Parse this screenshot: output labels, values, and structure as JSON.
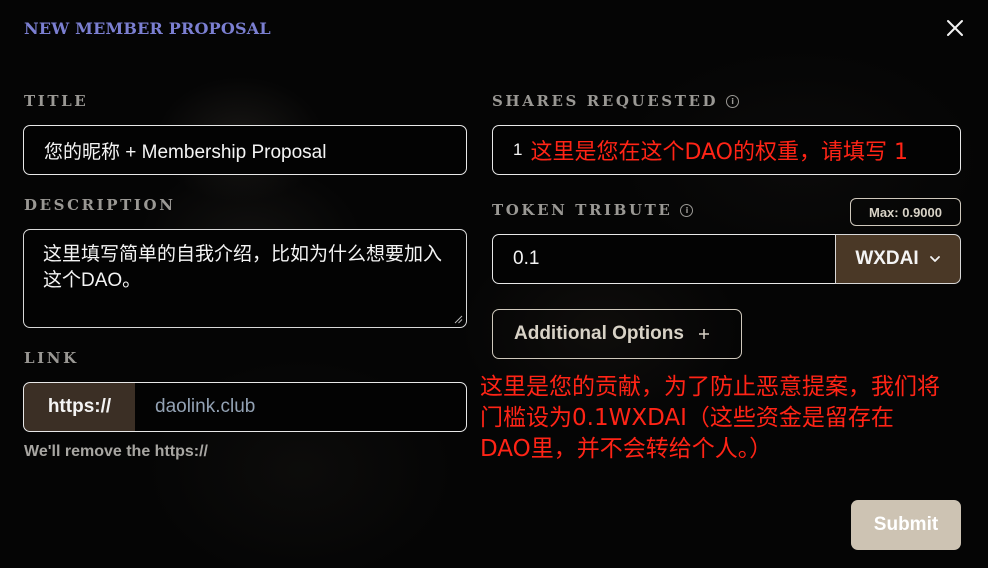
{
  "modal": {
    "title": "NEW MEMBER PROPOSAL",
    "close_icon": "close-icon"
  },
  "colors": {
    "title_accent": "#7b7fd1",
    "annotation_red": "#ff2416",
    "select_brown": "#4a3826",
    "submit_bg": "#cdc3b3"
  },
  "title_field": {
    "label": "TITLE",
    "value": "您的昵称 + Membership Proposal"
  },
  "description_field": {
    "label": "DESCRIPTION",
    "value": "这里填写简单的自我介绍，比如为什么想要加入这个DAO。"
  },
  "link_field": {
    "label": "LINK",
    "prefix": "https://",
    "placeholder": "daolink.club",
    "helper": "We'll remove the https://"
  },
  "shares_field": {
    "label": "SHARES REQUESTED",
    "info_icon": "info-icon",
    "value": "1",
    "annotation": "这里是您在这个DAO的权重，请填写 1"
  },
  "tribute_field": {
    "label": "TOKEN TRIBUTE",
    "info_icon": "info-icon",
    "max_badge": "Max: 0.9000",
    "value": "0.1",
    "token": "WXDAI",
    "token_icon": "chevron-down-icon"
  },
  "additional_options": {
    "label": "Additional Options",
    "icon": "plus-icon"
  },
  "annotation": {
    "lines": [
      "这里是您的贡献，为了防止恶意提案，我们将",
      "门槛设为0.1WXDAI（这些资金是留存在",
      "DAO里，并不会转给个人。）"
    ]
  },
  "submit": {
    "label": "Submit"
  }
}
